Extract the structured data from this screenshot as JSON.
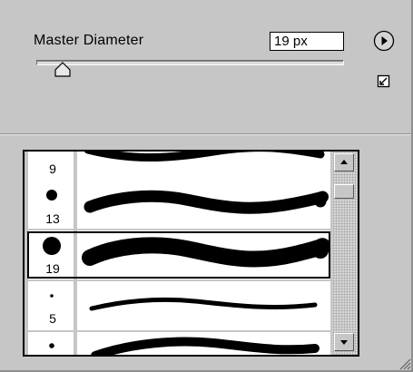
{
  "master_diameter": {
    "label": "Master Diameter",
    "value": "19 px",
    "slider_fraction": 0.08
  },
  "icons": {
    "play": "play-circle-icon",
    "menu": "panel-menu-icon",
    "grip": "resize-grip-icon"
  },
  "brush_list": {
    "items": [
      {
        "size_label": "9"
      },
      {
        "size_label": "13"
      },
      {
        "size_label": "19",
        "selected": true
      },
      {
        "size_label": "5"
      },
      {
        "size_label": ""
      }
    ]
  },
  "colors": {
    "panel_bg": "#c6c6c6",
    "stroke": "#000000"
  }
}
